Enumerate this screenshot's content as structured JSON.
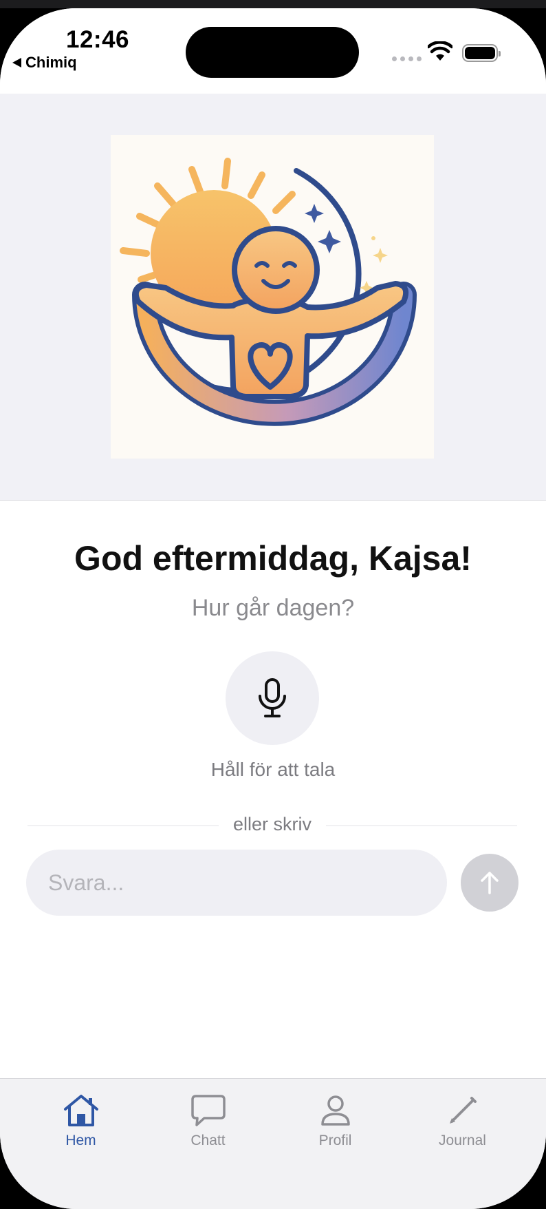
{
  "status_bar": {
    "time": "12:46",
    "back_app": "Chimiq"
  },
  "hero": {
    "logo_description": "sun-moon-hug-logo"
  },
  "main": {
    "greeting": "God eftermiddag, Kajsa!",
    "subtitle": "Hur går dagen?",
    "mic_label": "Håll för att tala",
    "divider_text": "eller skriv",
    "input_placeholder": "Svara..."
  },
  "tabs": [
    {
      "label": "Hem",
      "icon": "home-icon",
      "active": true
    },
    {
      "label": "Chatt",
      "icon": "chat-bubble-icon",
      "active": false
    },
    {
      "label": "Profil",
      "icon": "person-icon",
      "active": false
    },
    {
      "label": "Journal",
      "icon": "pencil-icon",
      "active": false
    }
  ],
  "colors": {
    "accent": "#2f57a5",
    "inactive": "#8e8e93",
    "hero_bg": "#f1f1f6",
    "input_bg": "#efeff4",
    "send_disabled": "#d1d1d6"
  }
}
